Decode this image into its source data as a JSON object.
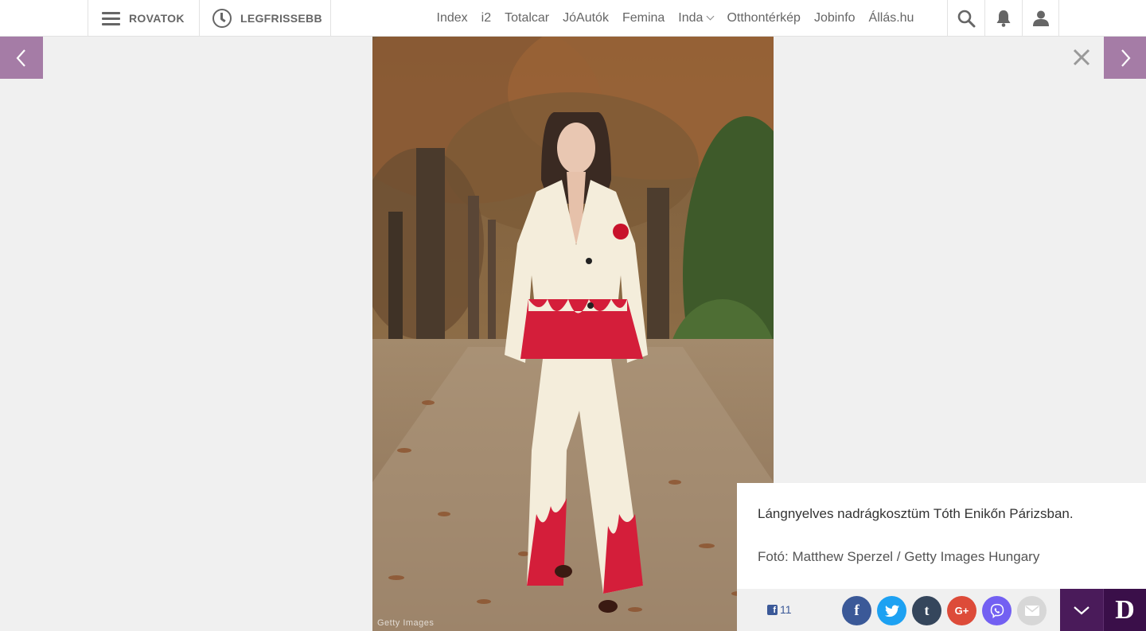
{
  "topbar": {
    "rovatok_label": "ROVATOK",
    "legfrissebb_label": "LEGFRISSEBB",
    "sites": [
      "Index",
      "i2",
      "Totalcar",
      "JóAutók",
      "Femina",
      "Inda",
      "Otthontérkép",
      "Jobinfo",
      "Állás.hu"
    ],
    "icons": [
      "search-icon",
      "bell-icon",
      "user-icon"
    ]
  },
  "gallery": {
    "prev_icon": "chevron-left-icon",
    "next_icon": "chevron-right-icon",
    "close_icon": "close-icon",
    "photo_watermark": "Getty Images",
    "caption": "Lángnyelves nadrágkosztüm Tóth Enikőn Párizsban.",
    "credit": "Fotó: Matthew Sperzel / Getty Images Hungary"
  },
  "share": {
    "fb_icon_letter": "f",
    "fb_count": "11",
    "buttons": [
      "facebook",
      "twitter",
      "tumblr",
      "google-plus",
      "viber",
      "email"
    ],
    "facebook_glyph": "f",
    "tumblr_glyph": "t",
    "googleplus_glyph": "G+",
    "brand_letter": "D"
  },
  "colors": {
    "accent_purple": "#a57ca6",
    "dark_purple": "#4a1b5a",
    "facebook": "#3b5998",
    "twitter": "#1da1f2",
    "tumblr": "#35465c",
    "googleplus": "#dd4b39",
    "viber": "#7360f2",
    "email": "#d7d7d7"
  }
}
